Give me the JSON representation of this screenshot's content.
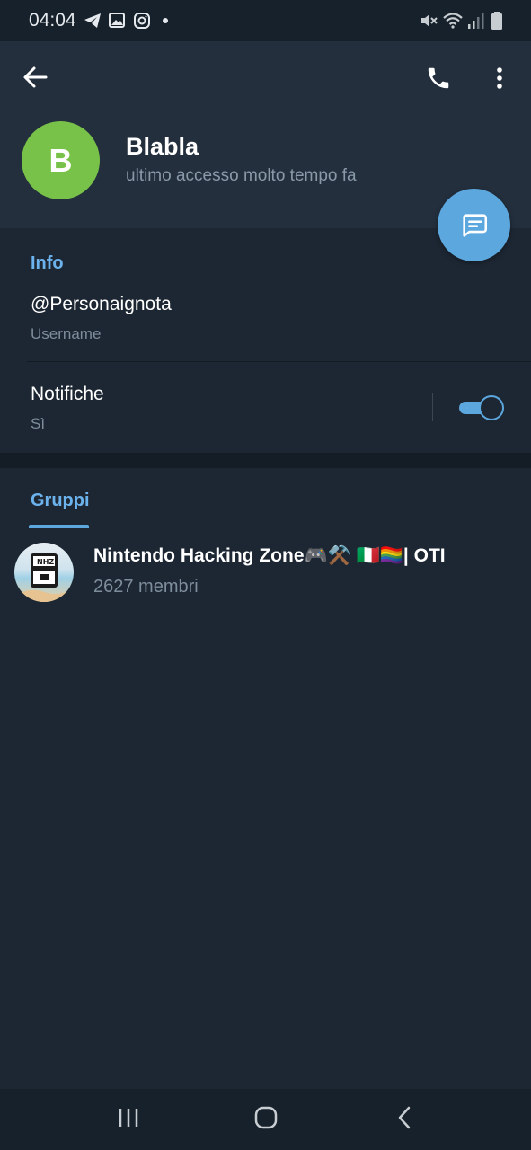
{
  "status_bar": {
    "time": "04:04",
    "left_icons": [
      "telegram-icon",
      "gallery-icon",
      "instagram-icon",
      "dot-icon"
    ],
    "right_icons": [
      "mute-icon",
      "wifi-icon",
      "signal-icon",
      "battery-icon"
    ]
  },
  "header": {
    "avatar_letter": "B",
    "avatar_color": "#79c24a",
    "name": "Blabla",
    "status": "ultimo accesso molto tempo fa"
  },
  "info": {
    "title": "Info",
    "username": "@Personaignota",
    "username_label": "Username",
    "notifications": "Notifiche",
    "notifications_value": "Sì",
    "notifications_enabled": true
  },
  "groups": {
    "tab_label": "Gruppi",
    "items": [
      {
        "name": "Nintendo Hacking Zone🎮⚒️ 🇮🇹🏳️‍🌈| OTI",
        "members": "2627 membri",
        "avatar_text": "NHZ"
      }
    ]
  },
  "colors": {
    "accent": "#5ca7de",
    "header_bg": "#232f3d",
    "page_bg": "#1d2733",
    "section_title": "#6cb2ec"
  },
  "nav_bar": [
    "recent-apps-icon",
    "home-icon",
    "back-icon"
  ]
}
